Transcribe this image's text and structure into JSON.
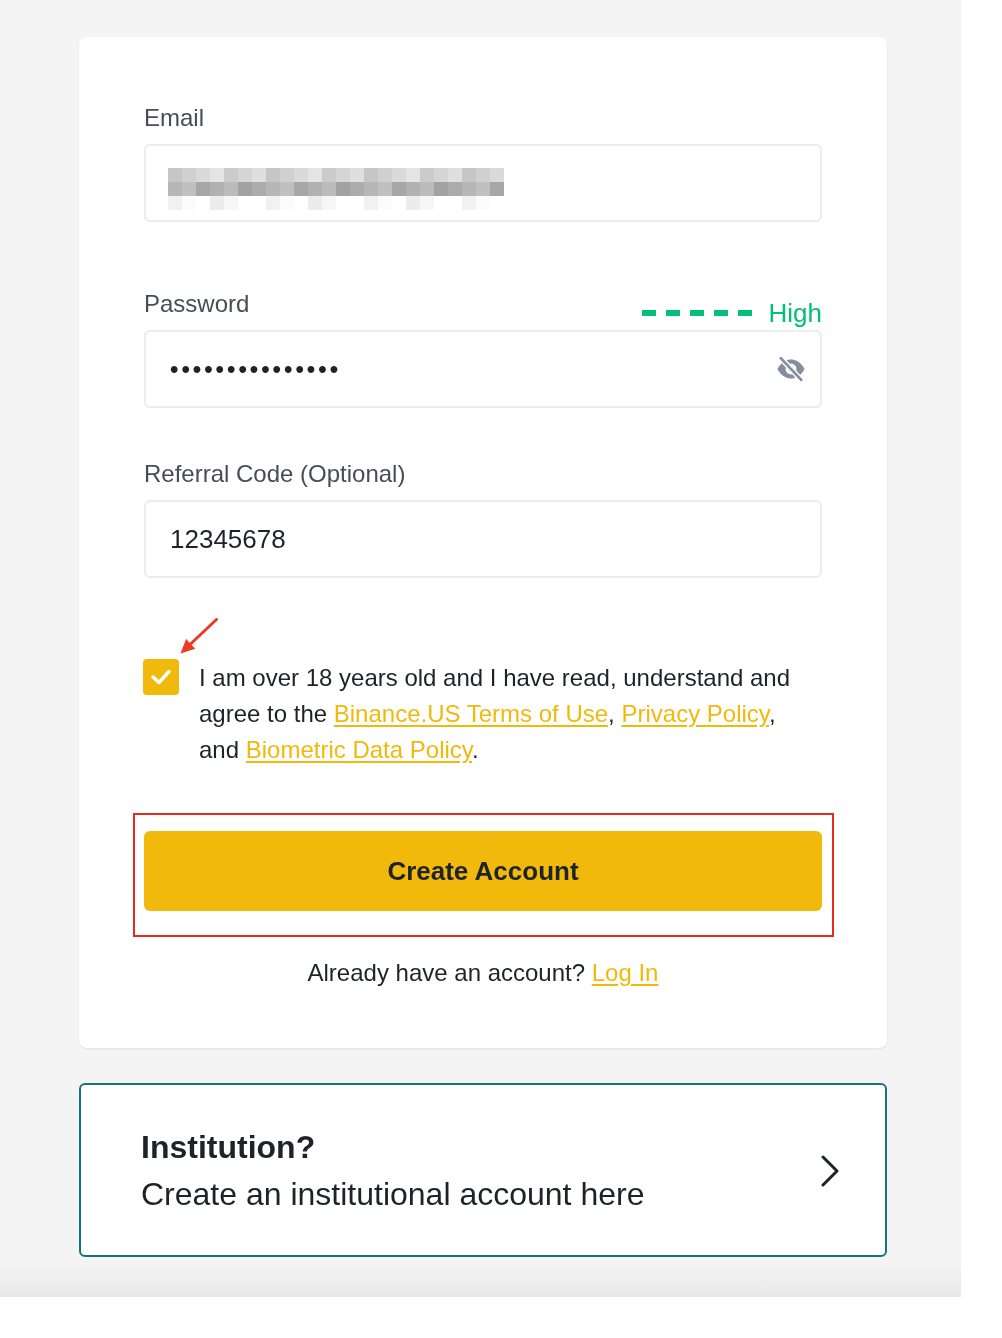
{
  "form": {
    "fields": [
      {
        "kind": "email",
        "label": "Email",
        "redacted": true
      },
      {
        "kind": "password",
        "label": "Password",
        "value": "•••••••••••••••",
        "strength": {
          "level": 1,
          "label": "High"
        }
      },
      {
        "kind": "referral",
        "label": "Referral Code (Optional)",
        "value": "12345678"
      }
    ],
    "agreement": {
      "checked": true,
      "marked_by_arrow": true,
      "parts": [
        {
          "kind": "text",
          "text": "I am over 18 years old and I have read, understand and agree to the "
        },
        {
          "kind": "link",
          "text": "Binance.US Terms of Use"
        },
        {
          "kind": "text",
          "text": ", "
        },
        {
          "kind": "link",
          "text": "Privacy Policy"
        },
        {
          "kind": "text",
          "text": ", and "
        },
        {
          "kind": "link",
          "text": "Biometric Data Policy"
        },
        {
          "kind": "text",
          "text": "."
        }
      ]
    },
    "submit_button": {
      "label": "Create Account",
      "highlighted": true
    },
    "login_prompt": {
      "text": "Already have an account?",
      "link": "Log In"
    }
  },
  "institution_card": {
    "title": "Institution?",
    "subtitle": "Create an institutional account here"
  }
}
